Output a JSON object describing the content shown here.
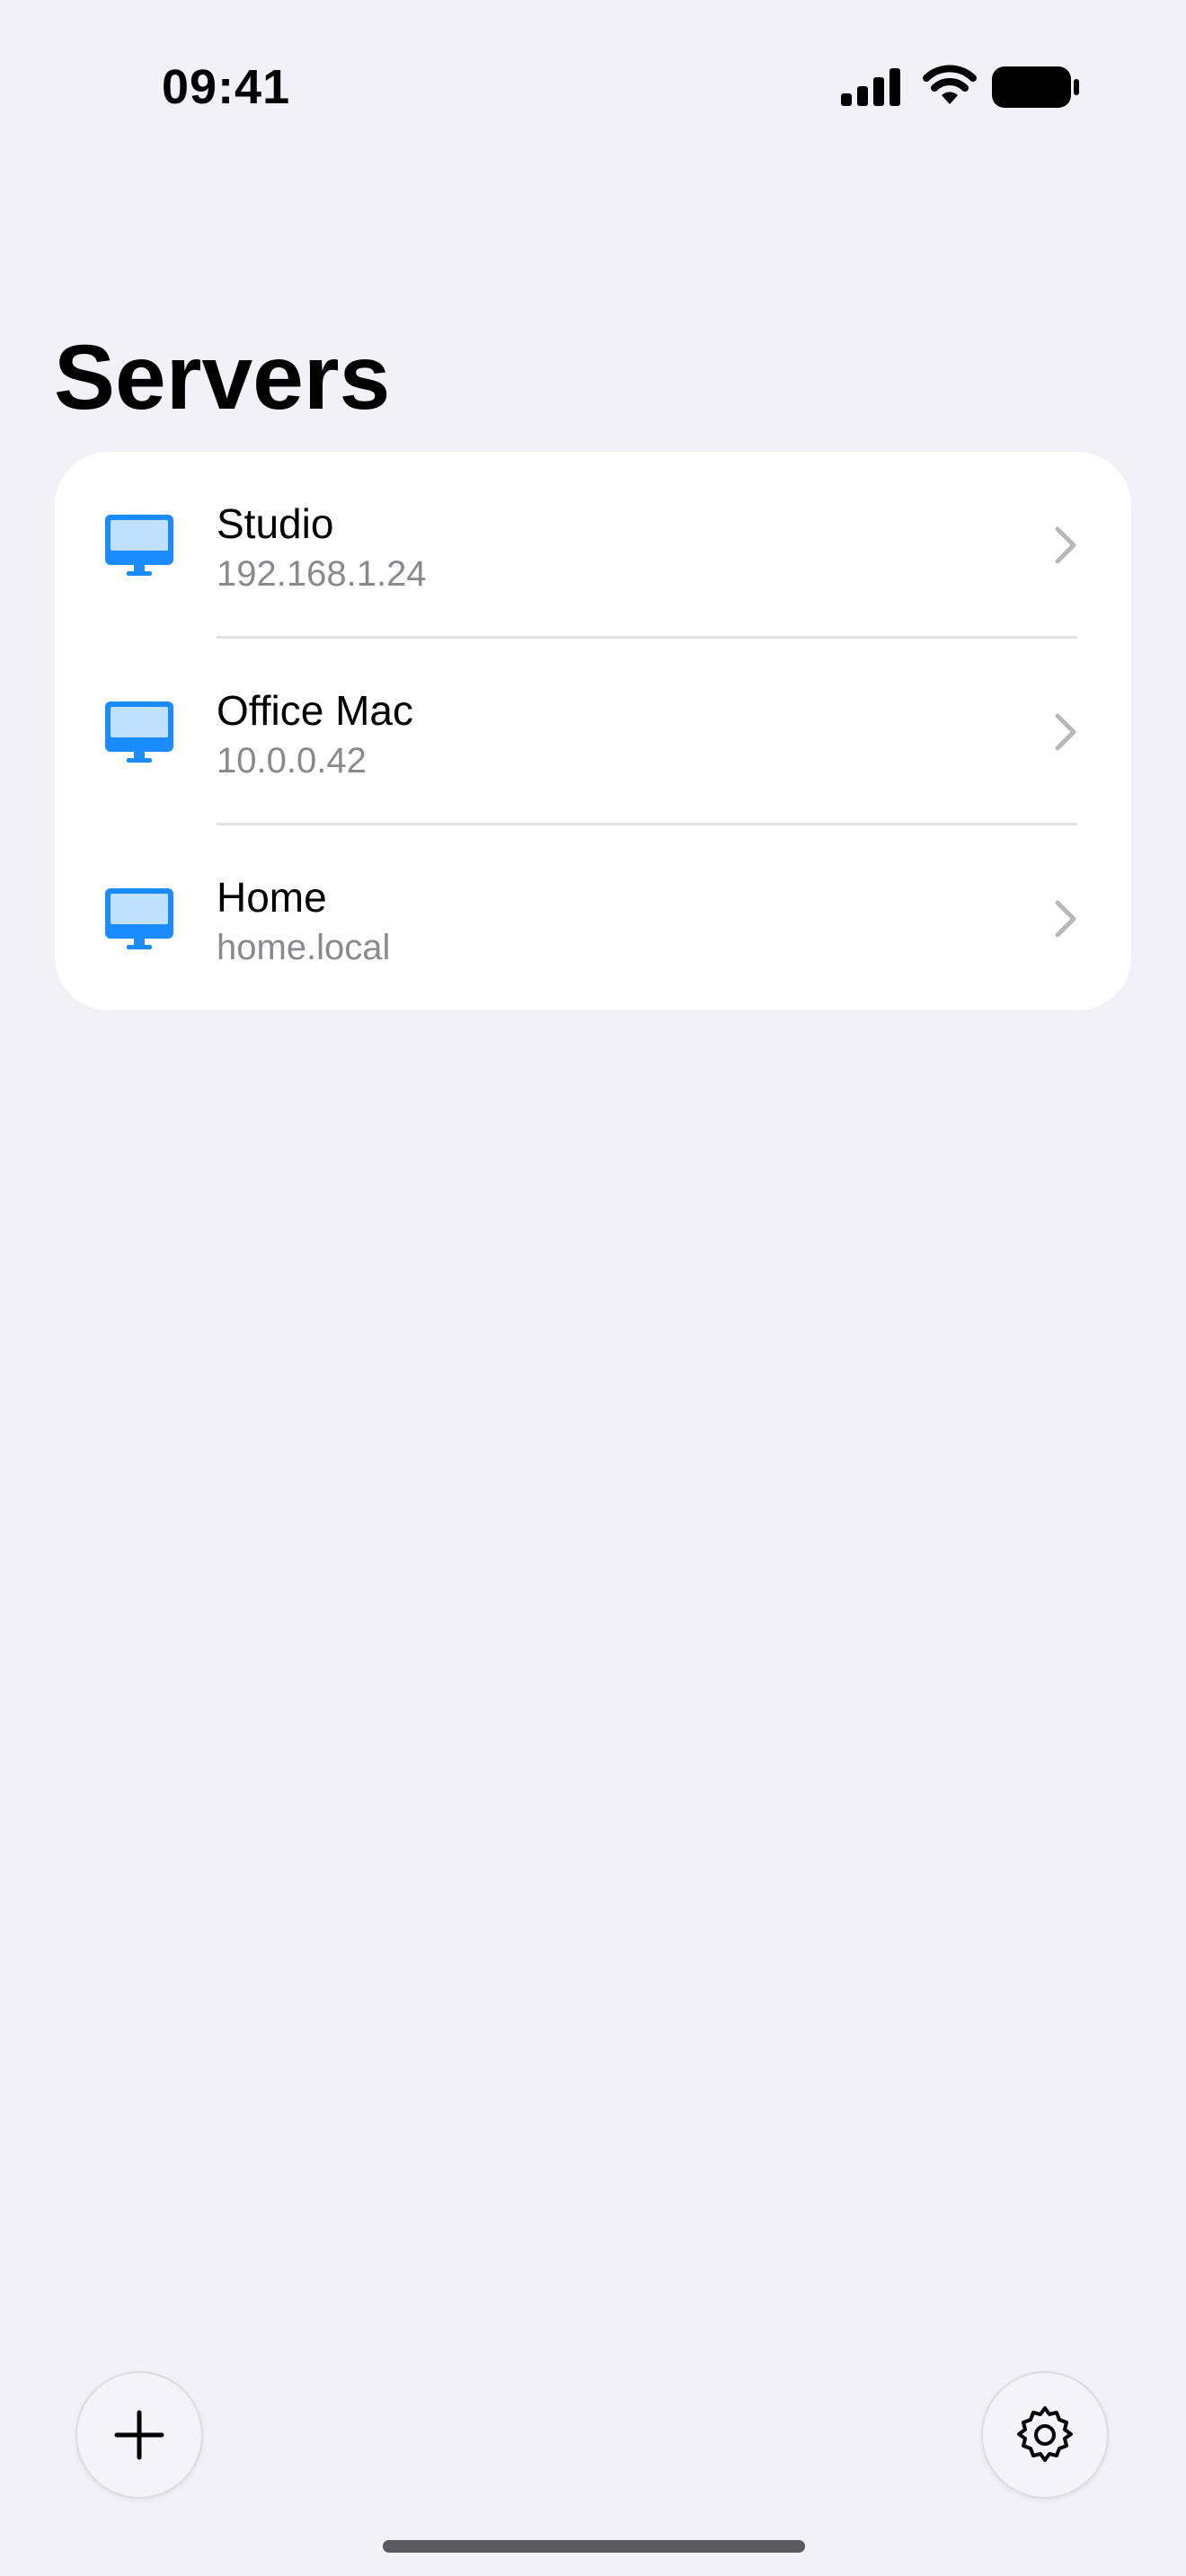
{
  "status_bar": {
    "time": "09:41",
    "icons": [
      "cellular-signal-icon",
      "wifi-icon",
      "battery-icon"
    ]
  },
  "header": {
    "title": "Servers"
  },
  "servers": [
    {
      "name": "Studio",
      "address": "192.168.1.24",
      "icon": "monitor-icon"
    },
    {
      "name": "Office Mac",
      "address": "10.0.0.42",
      "icon": "monitor-icon"
    },
    {
      "name": "Home",
      "address": "home.local",
      "icon": "monitor-icon"
    }
  ],
  "toolbar": {
    "add_icon": "plus-icon",
    "settings_icon": "gear-icon"
  },
  "colors": {
    "background": "#F2F1F7",
    "card": "#FFFFFF",
    "accent": "#1A8CFF",
    "secondary_text": "#8A8A8E",
    "chevron": "#B8B8BC"
  }
}
